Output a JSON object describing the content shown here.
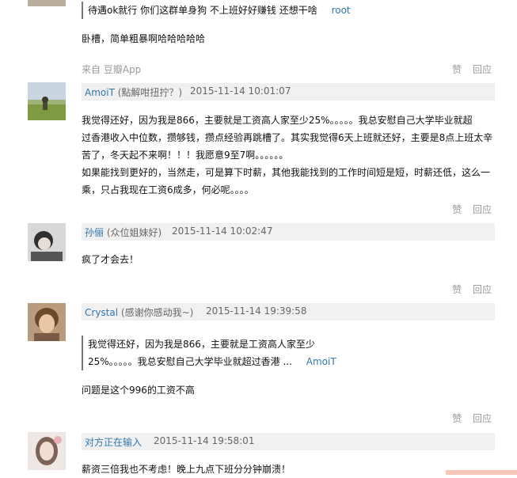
{
  "top_avatar_partial": true,
  "comment0": {
    "quote_text": "待遇ok就行 你们这群单身狗 不上班好好赚钱 还想干啥",
    "quote_author": "root",
    "body": "卧槽，简单粗暴啊哈哈哈哈哈",
    "source": "来自 豆瓣App"
  },
  "actions": {
    "like": "赞",
    "reply": "回应"
  },
  "comment1": {
    "user": "AmoiT",
    "signature": "(點解咁扭拧？)",
    "time": "2015-11-14 10:01:07",
    "lines": [
      "我觉得还好，因为我是866，主要就是工资高人家至少25%。。。。。我总安慰自己大学毕业就超",
      "过香港收入中位数，攒够钱，攒点经验再跳槽了。其实我觉得6天上班就还好，主要是8点上班太辛",
      "苦了，冬天起不来啊！！！我愿意9至7啊。。。。。。",
      "如果能找到更好的，当然走，可是算下时薪，其他我能找到的工作时间短是短，时薪还低，这么一",
      "乘，只占我现在工资6成多，何必呢。。。。"
    ]
  },
  "comment2": {
    "user": "孙俪",
    "signature": "(众位姐妹好)",
    "time": "2015-11-14 10:02:47",
    "body": "疯了才会去！"
  },
  "comment3": {
    "user": "Crystal",
    "signature": "(感谢你感动我~)",
    "time": "2015-11-14 19:39:58",
    "quote_lines": [
      "我觉得还好，因为我是866，主要就是工资高人家至少",
      "25%。。。。。我总安慰自己大学毕业就超过香港 ..."
    ],
    "quote_author": "AmoiT",
    "body": "问题是这个996的工资不高"
  },
  "comment4": {
    "user": "对方正在输入",
    "time": "2015-11-14 19:58:01",
    "body": "薪资三倍我也不考虑！晚上九点下班分分钟崩溃！"
  }
}
